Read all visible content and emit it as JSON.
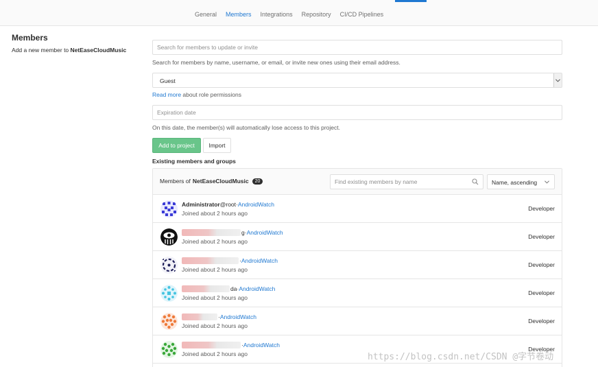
{
  "nav": {
    "tabs": [
      {
        "label": "General",
        "active": false
      },
      {
        "label": "Members",
        "active": true
      },
      {
        "label": "Integrations",
        "active": false
      },
      {
        "label": "Repository",
        "active": false
      },
      {
        "label": "CI/CD Pipelines",
        "active": false
      }
    ]
  },
  "left": {
    "title": "Members",
    "desc_prefix": "Add a new member to ",
    "project": "NetEaseCloudMusic"
  },
  "form": {
    "search_placeholder": "Search for members to update or invite",
    "search_help": "Search for members by name, username, or email, or invite new ones using their email address.",
    "role_value": "Guest",
    "role_help_link": "Read more",
    "role_help_text": " about role permissions",
    "expiration_placeholder": "Expiration date",
    "expiration_help": "On this date, the member(s) will automatically lose access to this project.",
    "add_button": "Add to project",
    "import_button": "Import"
  },
  "existing": {
    "title": "Existing members and groups",
    "panel_prefix": "Members of ",
    "project": "NetEaseCloudMusic",
    "count": "20",
    "find_placeholder": "Find existing members by name",
    "sort_value": "Name, ascending"
  },
  "members": [
    {
      "name": "Administrator",
      "username": " @root",
      "separator": " · ",
      "source": "AndroidWatch",
      "joined": "Joined about 2 hours ago",
      "role": "Developer",
      "avatar_color": "#3b3bd6"
    },
    {
      "name": "",
      "username": "g",
      "separator": " · ",
      "source": "AndroidWatch",
      "joined": "Joined about 2 hours ago",
      "role": "Developer",
      "avatar_color": "#111111"
    },
    {
      "name": "",
      "username": "",
      "separator": "· ",
      "source": "AndroidWatch",
      "joined": "Joined about 2 hours ago",
      "role": "Developer",
      "avatar_color": "#1f1f5a"
    },
    {
      "name": "",
      "username": "da",
      "separator": " · ",
      "source": "AndroidWatch",
      "joined": "Joined about 2 hours ago",
      "role": "Developer",
      "avatar_color": "#44c4e0"
    },
    {
      "name": "",
      "username": "",
      "separator": " · ",
      "source": "AndroidWatch",
      "joined": "Joined about 2 hours ago",
      "role": "Developer",
      "avatar_color": "#ee7a3a"
    },
    {
      "name": "",
      "username": "",
      "separator": " · ",
      "source": "AndroidWatch",
      "joined": "Joined about 2 hours ago",
      "role": "Developer",
      "avatar_color": "#3aa83a"
    }
  ],
  "watermark": "https://blog.csdn.net/CSDN @字节卷动"
}
